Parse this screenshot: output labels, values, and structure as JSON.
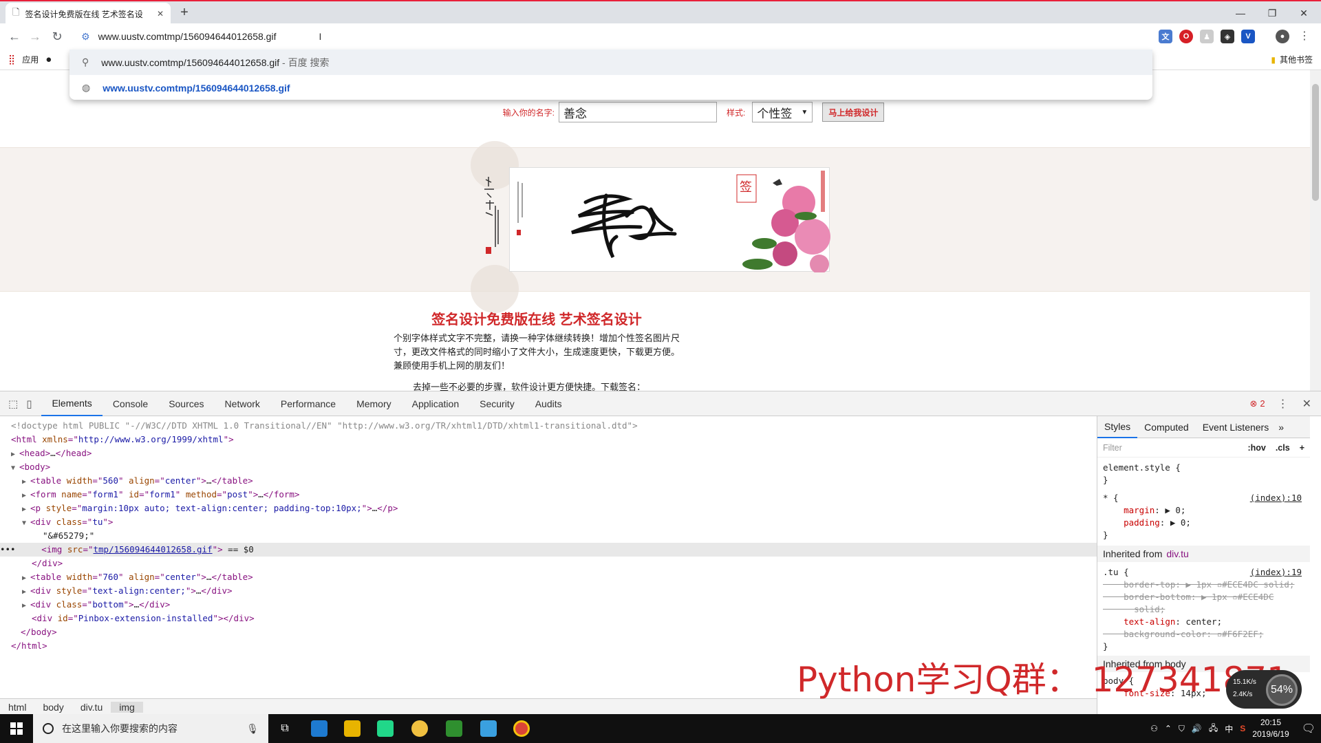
{
  "tab": {
    "title": "签名设计免费版在线 艺术签名设"
  },
  "window_controls": {
    "minimize": "—",
    "maximize": "❐",
    "close": "✕"
  },
  "omnibox": {
    "value": "www.uustv.comtmp/156094644012658.gif"
  },
  "suggestions": [
    {
      "text": "www.uustv.comtmp/156094644012658.gif",
      "sub": " - 百度 搜索",
      "type": "search"
    },
    {
      "text": "www.uustv.comtmp/156094644012658.gif",
      "sub": "",
      "type": "url"
    }
  ],
  "bookmarks": {
    "apps": "应用",
    "other": "其他书签"
  },
  "page": {
    "name_label": "输入你的名字:",
    "name_value": "善念",
    "style_label": "样式:",
    "style_value": "个性签",
    "design_button": "马上给我设计",
    "title": "签名设计免费版在线 艺术签名设计",
    "paragraph": "个别字体样式文字不完整，请换一种字体继续转换！增加个性签名图片尺寸，更改文件格式的同时缩小了文件大小，生成速度更快，下载更方便。兼顾使用手机上网的朋友们！",
    "paragraph2": "去掉一些不必要的步骤，软件设计更方便快捷。下载签名："
  },
  "devtools": {
    "tabs": [
      "Elements",
      "Console",
      "Sources",
      "Network",
      "Performance",
      "Memory",
      "Application",
      "Security",
      "Audits"
    ],
    "active_tab": "Elements",
    "error_count": "2",
    "breadcrumbs": [
      "html",
      "body",
      "div.tu",
      "img"
    ],
    "style_tabs": [
      "Styles",
      "Computed",
      "Event Listeners"
    ],
    "filter_placeholder": "Filter",
    "hov": ":hov",
    "cls": ".cls",
    "inherited_from": "Inherited from",
    "inherited_el": "div.tu"
  },
  "watermark": "Python学习Q群： 127341871",
  "speed": {
    "percent": "54%",
    "up": "15.1K/s",
    "down": "2.4K/s"
  },
  "taskbar": {
    "search_placeholder": "在这里输入你要搜索的内容",
    "time": "20:15",
    "date": "2019/6/19",
    "ime": "中"
  },
  "colors": {
    "accent_red": "#d0282a",
    "tu_bg": "#F6F2EF",
    "tu_border": "#ECE4DC",
    "link_blue": "#1a56c4"
  }
}
